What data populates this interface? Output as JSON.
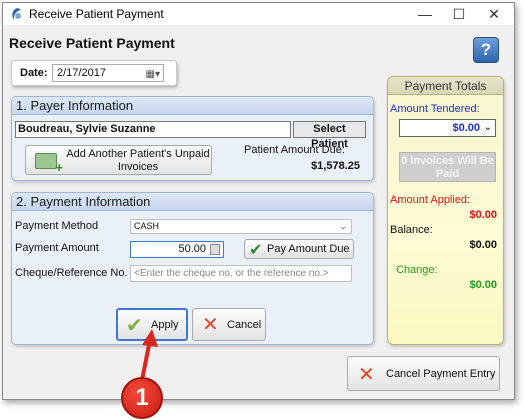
{
  "window": {
    "title": "Receive Patient Payment",
    "minimize_glyph": "—",
    "maximize_glyph": "☐",
    "close_glyph": "✕"
  },
  "heading": "Receive Patient Payment",
  "help": {
    "glyph": "?"
  },
  "date": {
    "label": "Date:",
    "value": "2/17/2017"
  },
  "payer": {
    "title": "1. Payer Information",
    "patient_name": "Boudreau, Sylvie Suzanne",
    "select_patient_label": "Select Patient",
    "add_invoices_label": "Add Another Patient's Unpaid Invoices",
    "amount_due_label": "Patient Amount Due:",
    "amount_due_value": "$1,578.25"
  },
  "payment": {
    "title": "2. Payment Information",
    "method_label": "Payment Method",
    "method_value": "CASH",
    "amount_label": "Payment Amount",
    "amount_value": "50.00",
    "pay_due_label": "Pay Amount Due",
    "cheque_label": "Cheque/Reference No.",
    "cheque_placeholder": "<Enter the cheque no. or the reference no.>",
    "apply_label": "Apply",
    "cancel_label": "Cancel"
  },
  "totals": {
    "title": "Payment Totals",
    "tendered_label": "Amount Tendered:",
    "tendered_value": "$0.00",
    "invoices_paid_label": "0 Invoices Will Be Paid",
    "applied_label": "Amount Applied:",
    "applied_value": "$0.00",
    "balance_label": "Balance:",
    "balance_value": "$0.00",
    "change_label": "Change:",
    "change_value": "$0.00",
    "colors": {
      "tendered": "#1b2fd1",
      "applied": "#e01515",
      "change": "#1e9b1e"
    }
  },
  "cancel_entry_label": "Cancel Payment Entry",
  "callout": {
    "number": "1",
    "color": "#d9261c"
  }
}
